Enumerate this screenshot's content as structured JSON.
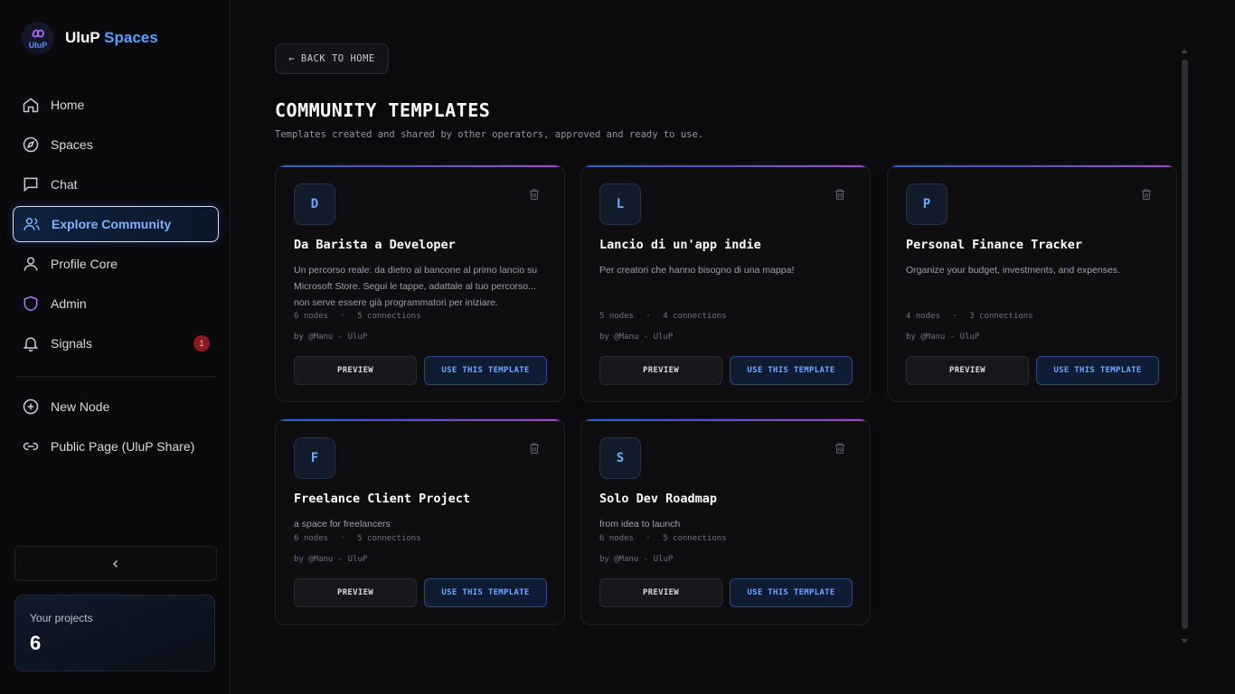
{
  "brand": {
    "logo_text": "UluP",
    "name_main": "UluP",
    "name_accent": "Spaces"
  },
  "nav": [
    {
      "label": "Home",
      "icon": "home-icon"
    },
    {
      "label": "Spaces",
      "icon": "compass-icon"
    },
    {
      "label": "Chat",
      "icon": "chat-icon"
    },
    {
      "label": "Explore Community",
      "icon": "users-icon",
      "active": true
    },
    {
      "label": "Profile Core",
      "icon": "user-icon"
    },
    {
      "label": "Admin",
      "icon": "shield-icon"
    },
    {
      "label": "Signals",
      "icon": "bell-icon",
      "badge": "1"
    }
  ],
  "nav_secondary": [
    {
      "label": "New Node",
      "icon": "plus-circle-icon"
    },
    {
      "label": "Public Page (UluP Share)",
      "icon": "link-icon"
    }
  ],
  "projects": {
    "label": "Your projects",
    "count": "6"
  },
  "back_button": "← BACK TO HOME",
  "page": {
    "title": "COMMUNITY TEMPLATES",
    "subtitle": "Templates created and shared by other operators, approved and ready to use."
  },
  "templates": [
    {
      "initial": "D",
      "title": "Da Barista a Developer",
      "description": "Un percorso reale: da dietro al bancone al primo lancio su Microsoft Store. Segui le tappe, adattale al tuo percorso... non serve essere già programmatori per iniziare.",
      "nodes": "6 nodes",
      "connections": "5 connections",
      "author": "by @Manu - UluP"
    },
    {
      "initial": "L",
      "title": "Lancio di un'app indie",
      "description": "Per creatori che hanno bisogno di una mappa!",
      "nodes": "5 nodes",
      "connections": "4 connections",
      "author": "by @Manu - UluP"
    },
    {
      "initial": "P",
      "title": "Personal Finance Tracker",
      "description": "Organize your budget, investments, and expenses.",
      "nodes": "4 nodes",
      "connections": "3 connections",
      "author": "by @Manu - UluP"
    },
    {
      "initial": "F",
      "title": "Freelance Client Project",
      "description": "a space for freelancers",
      "nodes": "6 nodes",
      "connections": "5 connections",
      "author": "by @Manu - UluP"
    },
    {
      "initial": "S",
      "title": "Solo Dev Roadmap",
      "description": "from idea to launch",
      "nodes": "6 nodes",
      "connections": "5 connections",
      "author": "by @Manu - UluP"
    }
  ],
  "buttons": {
    "preview": "PREVIEW",
    "use": "USE THIS TEMPLATE"
  },
  "meta_separator": "·",
  "colors": {
    "accent": "#5aa0ff",
    "badge": "#8a1a1f",
    "background": "#0b0b0d"
  }
}
